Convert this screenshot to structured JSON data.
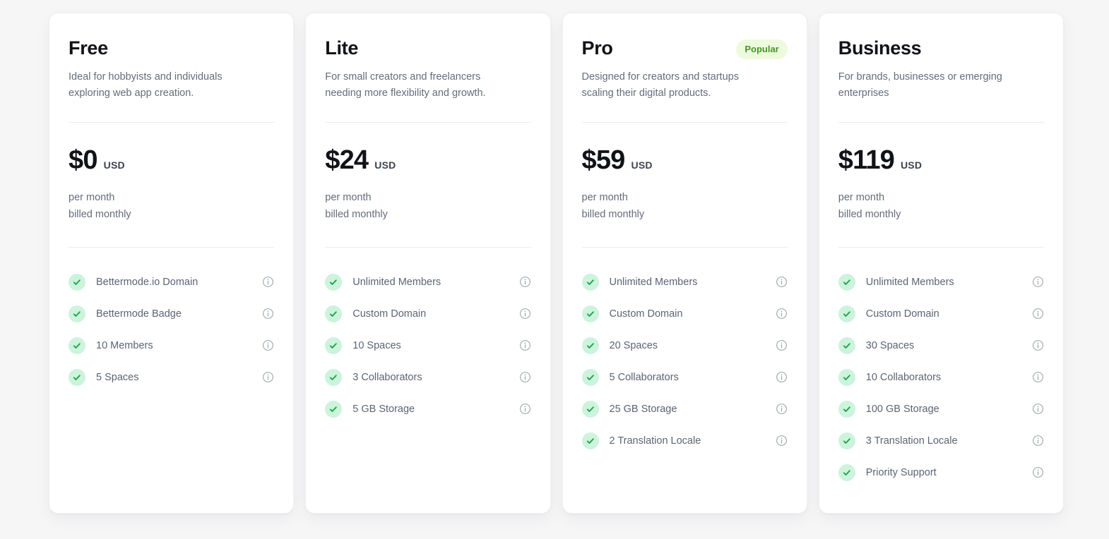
{
  "theme": {
    "page_background": "#f6f6f7",
    "card_background": "#ffffff",
    "accent_green": "#16a34a",
    "check_circle_background": "#cdf3dc",
    "badge_background": "#eefadd",
    "badge_text": "#4a9130",
    "heading_text": "#111318",
    "muted_text": "#646c7a",
    "feature_text": "#5b6474",
    "divider": "#ececee",
    "info_icon": "#9aa0ab"
  },
  "icons": {
    "check": "check-icon",
    "info": "info-icon"
  },
  "plans": [
    {
      "name": "Free",
      "badge": "",
      "description": "Ideal for hobbyists and individuals exploring web app creation.",
      "price": "$0",
      "currency": "USD",
      "period": "per month",
      "billing": "billed monthly",
      "features": [
        "Bettermode.io Domain",
        "Bettermode Badge",
        "10 Members",
        "5 Spaces"
      ]
    },
    {
      "name": "Lite",
      "badge": "",
      "description": "For small creators and freelancers needing more flexibility and growth.",
      "price": "$24",
      "currency": "USD",
      "period": "per month",
      "billing": "billed monthly",
      "features": [
        "Unlimited Members",
        "Custom Domain",
        "10 Spaces",
        "3 Collaborators",
        "5 GB Storage"
      ]
    },
    {
      "name": "Pro",
      "badge": "Popular",
      "description": "Designed for creators and startups scaling their digital products.",
      "price": "$59",
      "currency": "USD",
      "period": "per month",
      "billing": "billed monthly",
      "features": [
        "Unlimited Members",
        "Custom Domain",
        "20 Spaces",
        "5 Collaborators",
        "25 GB Storage",
        "2 Translation Locale"
      ]
    },
    {
      "name": "Business",
      "badge": "",
      "description": "For brands, businesses or emerging enterprises",
      "price": "$119",
      "currency": "USD",
      "period": "per month",
      "billing": "billed monthly",
      "features": [
        "Unlimited Members",
        "Custom Domain",
        "30 Spaces",
        "10 Collaborators",
        "100 GB Storage",
        "3 Translation Locale",
        "Priority Support"
      ]
    }
  ]
}
